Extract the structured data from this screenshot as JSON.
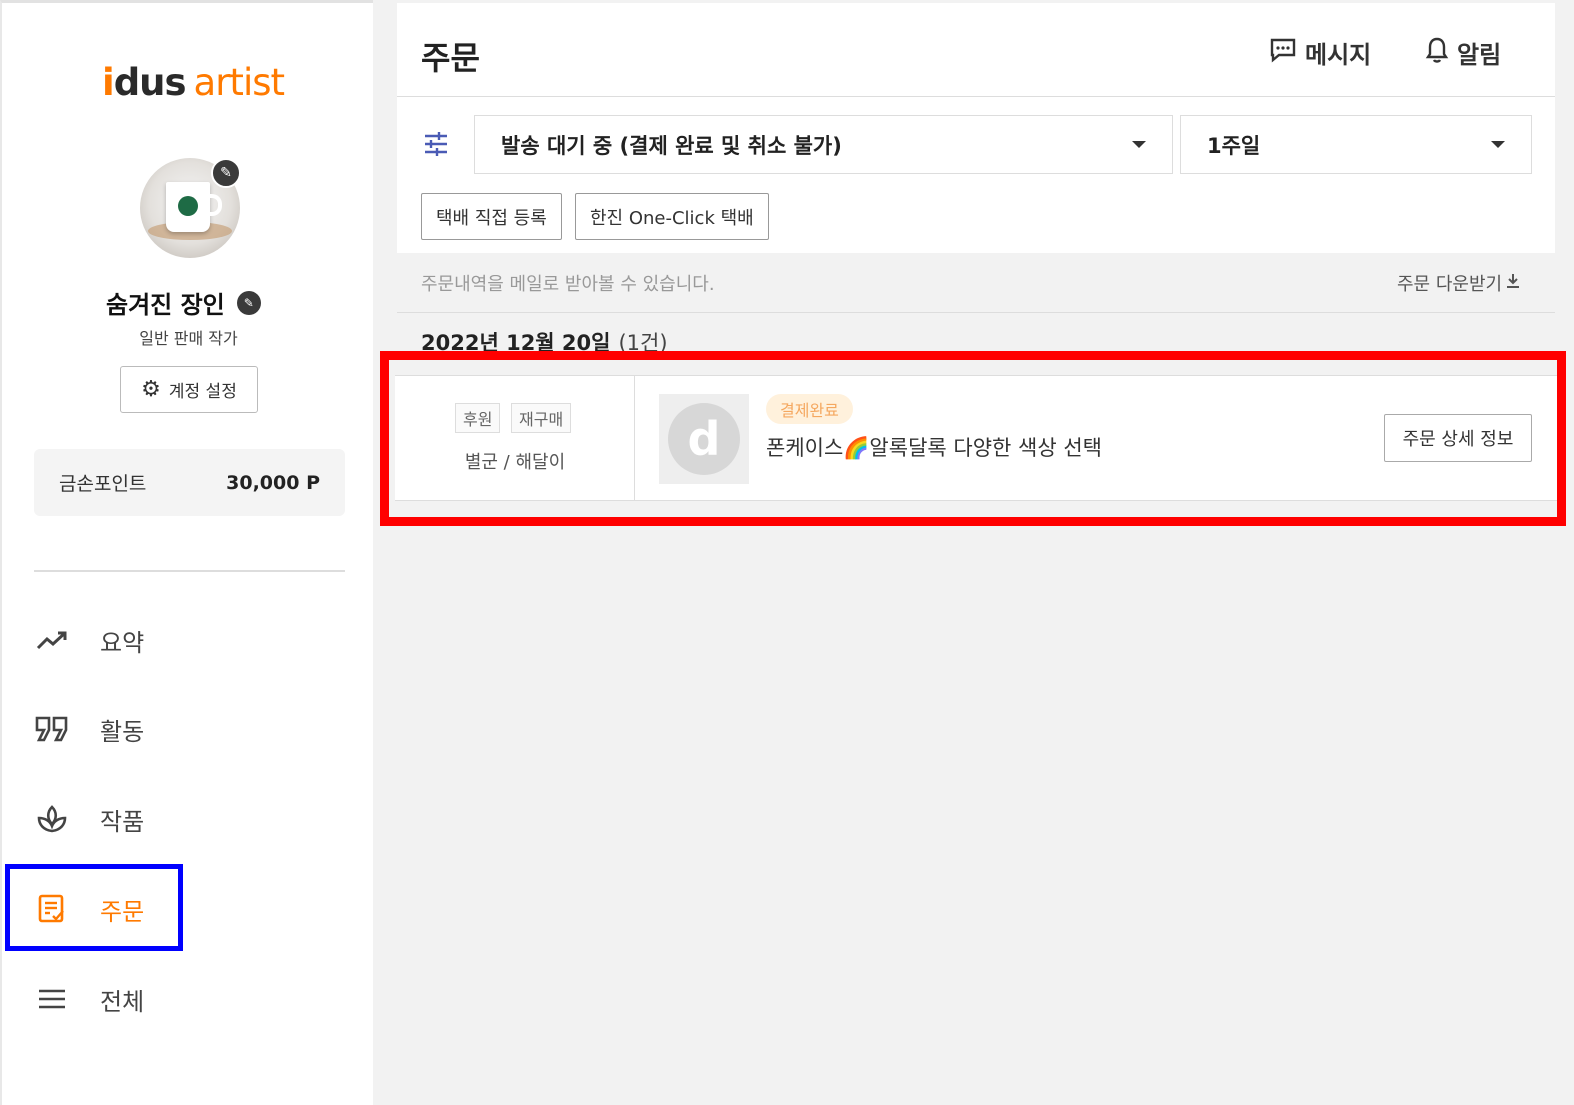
{
  "sidebar": {
    "logo": {
      "i": "i",
      "dus": "dus",
      "artist": "artist"
    },
    "artist_name": "숨겨진 장인",
    "artist_role": "일반 판매 작가",
    "settings_label": "계정 설정",
    "points": {
      "label": "금손포인트",
      "value": "30,000 P"
    },
    "nav": [
      {
        "label": "요약",
        "icon": "trend-up-icon"
      },
      {
        "label": "활동",
        "icon": "quote-icon"
      },
      {
        "label": "작품",
        "icon": "sprout-icon"
      },
      {
        "label": "주문",
        "icon": "order-list-icon",
        "active": true
      },
      {
        "label": "전체",
        "icon": "menu-icon"
      }
    ]
  },
  "header": {
    "title": "주문",
    "message_label": "메시지",
    "alarm_label": "알림"
  },
  "filters": {
    "status_select": "발송 대기 중 (결제 완료 및 취소 불가)",
    "period_select": "1주일",
    "buttons": [
      "택배 직접 등록",
      "한진 One-Click 택배"
    ]
  },
  "info": {
    "email_notice": "주문내역을 메일로 받아볼 수 있습니다.",
    "download_label": "주문 다운받기"
  },
  "orders": {
    "date": "2022년 12월 20일",
    "count": "(1건)",
    "items": [
      {
        "tags": [
          "후원",
          "재구매"
        ],
        "buyer": "별군 / 해달이",
        "status": "결제완료",
        "product": "폰케이스🌈알록달록 다양한 색상 선택",
        "detail_button": "주문 상세 정보"
      }
    ]
  },
  "colors": {
    "accent": "#ff7a00",
    "highlight_red": "#ff0000",
    "highlight_blue": "#0000ff",
    "paid_badge_bg": "#fff1dc",
    "paid_badge_text": "#f5a860"
  }
}
